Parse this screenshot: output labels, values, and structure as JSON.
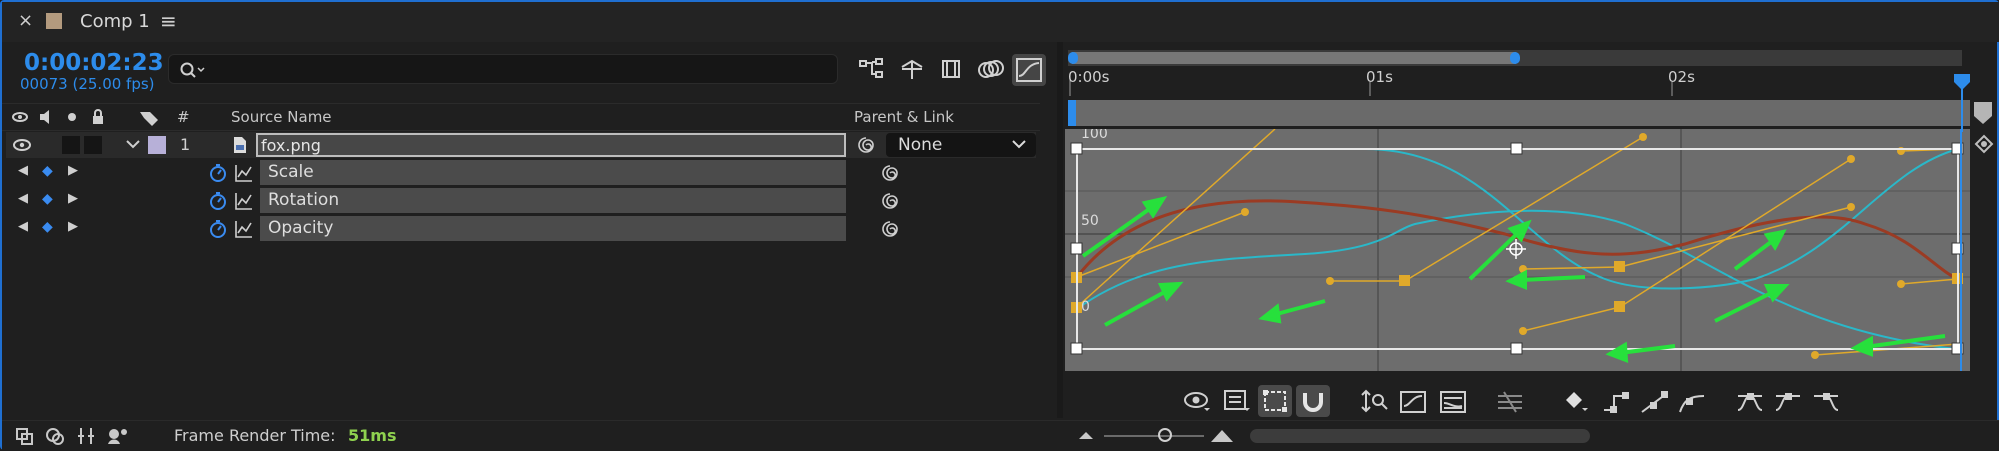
{
  "tab": {
    "close": "×",
    "title": "Comp 1",
    "menu": "≡"
  },
  "timecode": "0:00:02:23",
  "frames": "00073 (25.00 fps)",
  "search": {
    "placeholder": ""
  },
  "columns": {
    "number": "#",
    "source_name": "Source Name",
    "parent_link": "Parent & Link"
  },
  "layer": {
    "number": "1",
    "name": "fox.png",
    "parent": "None"
  },
  "properties": [
    {
      "label": "Scale"
    },
    {
      "label": "Rotation"
    },
    {
      "label": "Opacity"
    }
  ],
  "ruler": {
    "labels": [
      "0:00s",
      "01s",
      "02s"
    ]
  },
  "graph": {
    "y_labels": [
      "100",
      "50",
      "0"
    ]
  },
  "footer": {
    "render_label": "Frame Render Time:",
    "render_value": "51ms"
  },
  "icons": [
    "close-icon",
    "composition-swatch-icon",
    "panel-menu-icon",
    "search-icon",
    "flowchart-icon",
    "draft-3d-icon",
    "frame-blending-icon",
    "motion-blur-icon",
    "graph-editor-icon",
    "eye-icon",
    "audio-icon",
    "solo-icon",
    "lock-icon",
    "label-icon",
    "stopwatch-icon",
    "graph-icon",
    "pick-whip-icon",
    "keyframe-icon"
  ],
  "colors": {
    "accent": "#2d8ceb",
    "keyframe": "#3a8bf0",
    "curve_cyan": "#2ab8c9",
    "curve_red": "#9b3b23",
    "handle": "#e0a92a",
    "arrow": "#27e03c",
    "render_value": "#8fd14f"
  }
}
